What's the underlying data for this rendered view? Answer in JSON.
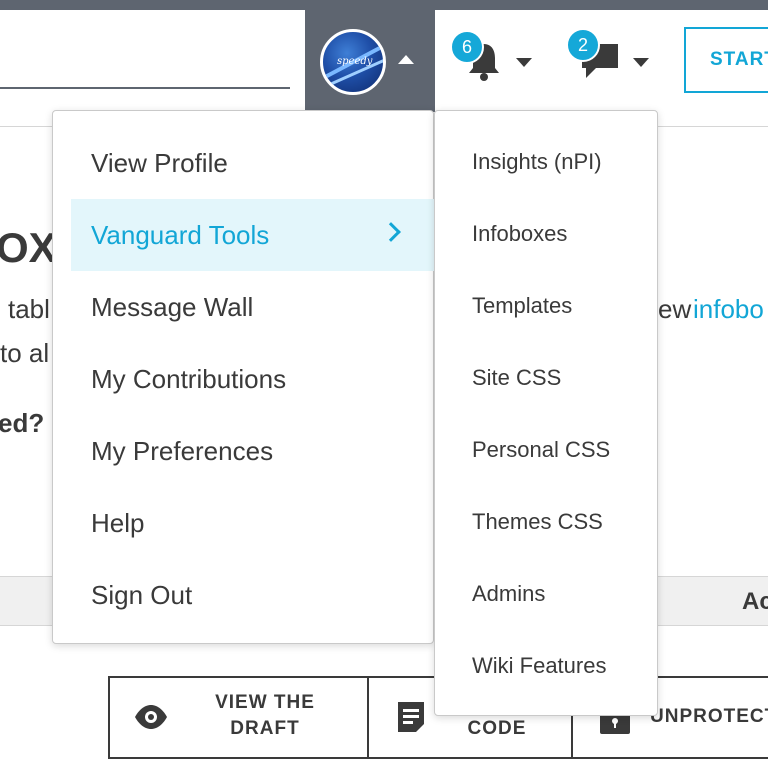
{
  "header": {
    "notifications_count": "6",
    "messages_count": "2",
    "start_button_label": "START",
    "avatar_signature": "speedy"
  },
  "background": {
    "heading_fragment": "OX",
    "line1_left": "tabl",
    "line1_right": "ew",
    "line1_link": "infobo",
    "line2_left": "to al",
    "line3_left": "ed?",
    "table_header_fragment": "Ac"
  },
  "actions": {
    "view_draft_line1": "VIEW THE",
    "view_draft_line2": "DRAFT",
    "code_label": "CODE",
    "unprotect_label": "UNPROTECT"
  },
  "user_menu": {
    "items": [
      {
        "label": "View Profile"
      },
      {
        "label": "Vanguard Tools",
        "active": true
      },
      {
        "label": "Message Wall"
      },
      {
        "label": "My Contributions"
      },
      {
        "label": "My Preferences"
      },
      {
        "label": "Help"
      },
      {
        "label": "Sign Out"
      }
    ]
  },
  "tools_submenu": {
    "items": [
      {
        "label": "Insights (nPI)"
      },
      {
        "label": "Infoboxes"
      },
      {
        "label": "Templates"
      },
      {
        "label": "Site CSS"
      },
      {
        "label": "Personal CSS"
      },
      {
        "label": "Themes CSS"
      },
      {
        "label": "Admins"
      },
      {
        "label": "Wiki Features"
      }
    ]
  },
  "colors": {
    "accent": "#12a6d6",
    "nav_dark": "#5e6570",
    "active_bg": "#e3f6fb",
    "text": "#3a3a3a"
  }
}
